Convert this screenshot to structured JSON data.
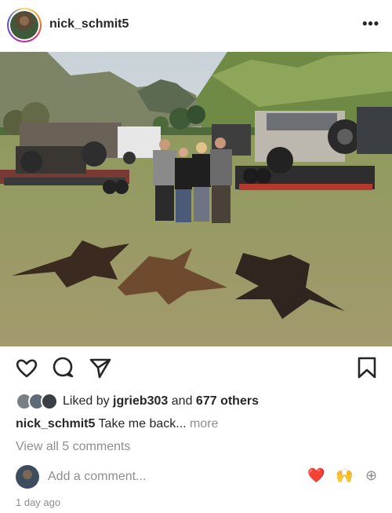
{
  "post": {
    "username": "nick_schmit5",
    "more_icon": "•••",
    "likes": {
      "prefix": "Liked by",
      "first_liker": "jgrieb303",
      "connector": "and",
      "others": "677 others"
    },
    "caption": {
      "username": "nick_schmit5",
      "text": "Take me back...",
      "more": "more"
    },
    "view_comments": "View all 5 comments",
    "comment_input": {
      "placeholder": "Add a comment..."
    },
    "quick_reactions": [
      "❤️",
      "🙌",
      "⊕"
    ],
    "timestamp": "1 day ago"
  }
}
